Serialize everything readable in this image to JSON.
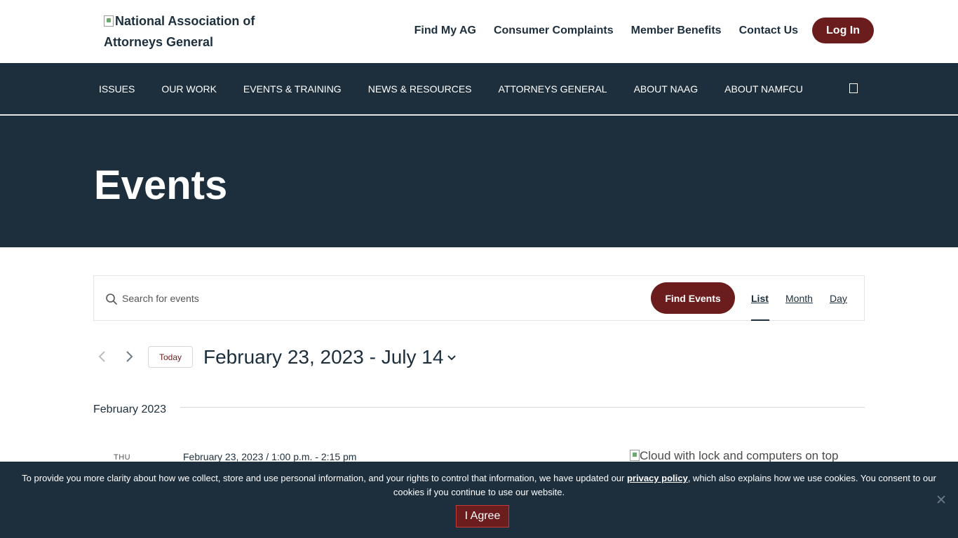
{
  "header": {
    "logo_alt": "National Association of Attorneys General",
    "utility_links": [
      "Find My AG",
      "Consumer Complaints",
      "Member Benefits",
      "Contact Us"
    ],
    "login_label": "Log In"
  },
  "nav": {
    "items": [
      "ISSUES",
      "OUR WORK",
      "EVENTS & TRAINING",
      "NEWS & RESOURCES",
      "ATTORNEYS GENERAL",
      "ABOUT NAAG",
      "ABOUT NAMFCU"
    ],
    "search_icon": "search-icon"
  },
  "hero": {
    "title": "Events"
  },
  "search": {
    "placeholder": "Search for events",
    "find_label": "Find Events",
    "views": [
      "List",
      "Month",
      "Day"
    ],
    "active_view": "List"
  },
  "date_nav": {
    "today_label": "Today",
    "range": "February 23, 2023 - July 14"
  },
  "events": {
    "month": "February 2023",
    "items": [
      {
        "weekday": "THU",
        "datetime": "February 23, 2023 / 1:00 p.m. - 2:15 pm",
        "image_alt": "Cloud with lock and computers on top"
      }
    ]
  },
  "cookie": {
    "text_before": "To provide you more clarity about how we collect, store and use personal information, and your rights to control that information, we have updated our ",
    "link": "privacy policy",
    "text_after": ", which also explains how we use cookies. You consent to our cookies if you continue to use our website.",
    "agree_label": "I Agree"
  },
  "colors": {
    "navy": "#1d2f3d",
    "maroon": "#6b1c1c",
    "white": "#ffffff"
  }
}
